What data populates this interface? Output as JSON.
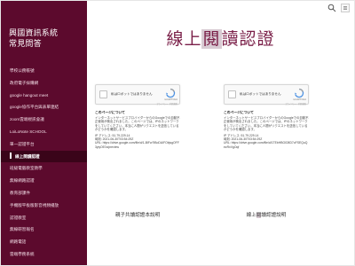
{
  "site": {
    "title_line1": "興國資訊系統",
    "title_line2": "常見問答"
  },
  "nav": {
    "items": [
      {
        "label": "學校公務帳號"
      },
      {
        "label": "政府電子採購網"
      },
      {
        "label": "google hangout meet"
      },
      {
        "label": "google協作平台與表單連結"
      },
      {
        "label": "zoom雲端視訊會議"
      },
      {
        "label": "LoiLoNote SCHOOL"
      },
      {
        "label": "單一認證平台"
      },
      {
        "label": "線上閱讀認證"
      },
      {
        "label": "班級電腦教室教學"
      },
      {
        "label": "無線網路認證"
      },
      {
        "label": "教育部課件"
      },
      {
        "label": "手機版平板版影音視頻播放"
      },
      {
        "label": "認證教室"
      },
      {
        "label": "無線研習報名"
      },
      {
        "label": "網路電話"
      },
      {
        "label": "雲端學務系統"
      }
    ],
    "active_index": 7
  },
  "page": {
    "title_prefix": "線上",
    "title_highlight": "閱",
    "title_suffix": "讀認證"
  },
  "cards": [
    {
      "recaptcha": {
        "label": "私はロボットではありません",
        "brand": "reCAPTCHA",
        "terms": "プライバシー - 利用規約"
      },
      "heading": "このページについて",
      "body": "インターネットサービスプロバイダーからのGoogleでの自動不正使用が検出されました。このページでは、IPのネットワークをしていてください。本当に人間がリクエストを送信しているかどうかを確認します。",
      "ip": "IP アドレス: 51.79.229.14",
      "time": "時刻: 2021-06-30T03:54:29Z",
      "url": "URL: https://drive.google.com/file/d/1-BIFw7tBoDAIFObjsgOFF3yiyO57a/preview",
      "caption": "親子共讀認證本說明"
    },
    {
      "recaptcha": {
        "label": "私はロボットではありません",
        "brand": "reCAPTCHA",
        "terms": "プライバシー - 利用規約"
      },
      "heading": "このページについて",
      "body": "インターネットサービスプロバイダーからのGoogleでの自動不正使用が検出されました。このページでは、IPのネットワークをしていてください。本当に人間がリクエストを送信しているかどうかを確認します。",
      "ip": "IP アドレス: 51.79.229.14",
      "time": "時刻: 2021-06-30T03:54:29Z",
      "url": "URL: https://drive.google.com/file/d/1TEbHBGlO8D7oFSEQuQezRxVgOqf",
      "caption_prefix": "線上",
      "caption_highlight": "閱",
      "caption_suffix": "讀認證說明"
    }
  ],
  "colors": {
    "sidebar": "#5c0a2d",
    "sidebar_active": "#3a0419",
    "title": "#7a1f48",
    "highlight": "#d8cbd3"
  },
  "icons": {
    "search": "search-icon",
    "menu": "menu-icon",
    "recaptcha": "recaptcha-logo-icon"
  }
}
